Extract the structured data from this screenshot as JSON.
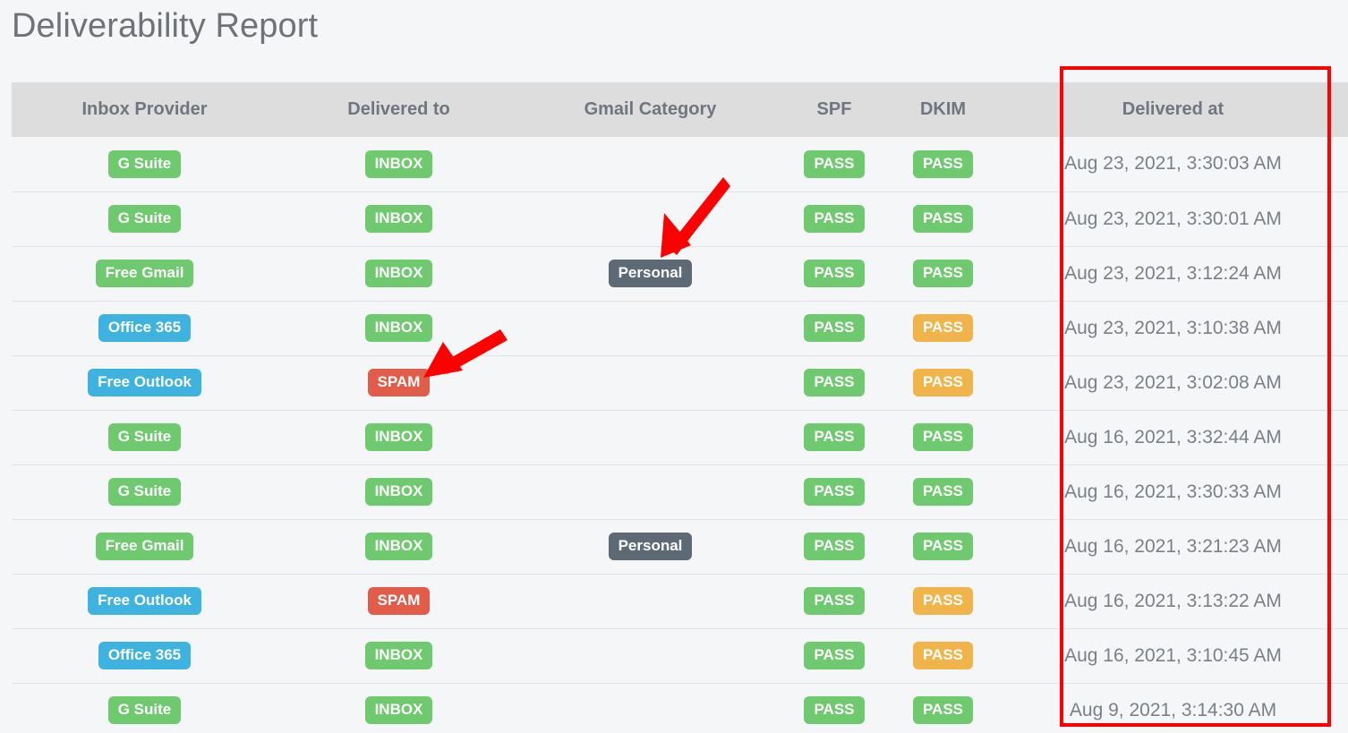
{
  "page": {
    "title": "Deliverability Report"
  },
  "table": {
    "columns": [
      {
        "key": "provider",
        "label": "Inbox Provider"
      },
      {
        "key": "delivered",
        "label": "Delivered to"
      },
      {
        "key": "category",
        "label": "Gmail Category"
      },
      {
        "key": "spf",
        "label": "SPF"
      },
      {
        "key": "dkim",
        "label": "DKIM"
      },
      {
        "key": "at",
        "label": "Delivered at"
      }
    ],
    "rows": [
      {
        "provider": "G Suite",
        "provider_color": "green",
        "delivered": "INBOX",
        "delivered_color": "green",
        "category": "",
        "category_color": "",
        "spf": "PASS",
        "spf_color": "green",
        "dkim": "PASS",
        "dkim_color": "green",
        "at": "Aug 23, 2021, 3:30:03 AM"
      },
      {
        "provider": "G Suite",
        "provider_color": "green",
        "delivered": "INBOX",
        "delivered_color": "green",
        "category": "",
        "category_color": "",
        "spf": "PASS",
        "spf_color": "green",
        "dkim": "PASS",
        "dkim_color": "green",
        "at": "Aug 23, 2021, 3:30:01 AM"
      },
      {
        "provider": "Free Gmail",
        "provider_color": "green",
        "delivered": "INBOX",
        "delivered_color": "green",
        "category": "Personal",
        "category_color": "slate",
        "spf": "PASS",
        "spf_color": "green",
        "dkim": "PASS",
        "dkim_color": "green",
        "at": "Aug 23, 2021, 3:12:24 AM"
      },
      {
        "provider": "Office 365",
        "provider_color": "blue",
        "delivered": "INBOX",
        "delivered_color": "green",
        "category": "",
        "category_color": "",
        "spf": "PASS",
        "spf_color": "green",
        "dkim": "PASS",
        "dkim_color": "amber",
        "at": "Aug 23, 2021, 3:10:38 AM"
      },
      {
        "provider": "Free Outlook",
        "provider_color": "blue",
        "delivered": "SPAM",
        "delivered_color": "red",
        "category": "",
        "category_color": "",
        "spf": "PASS",
        "spf_color": "green",
        "dkim": "PASS",
        "dkim_color": "amber",
        "at": "Aug 23, 2021, 3:02:08 AM"
      },
      {
        "provider": "G Suite",
        "provider_color": "green",
        "delivered": "INBOX",
        "delivered_color": "green",
        "category": "",
        "category_color": "",
        "spf": "PASS",
        "spf_color": "green",
        "dkim": "PASS",
        "dkim_color": "green",
        "at": "Aug 16, 2021, 3:32:44 AM"
      },
      {
        "provider": "G Suite",
        "provider_color": "green",
        "delivered": "INBOX",
        "delivered_color": "green",
        "category": "",
        "category_color": "",
        "spf": "PASS",
        "spf_color": "green",
        "dkim": "PASS",
        "dkim_color": "green",
        "at": "Aug 16, 2021, 3:30:33 AM"
      },
      {
        "provider": "Free Gmail",
        "provider_color": "green",
        "delivered": "INBOX",
        "delivered_color": "green",
        "category": "Personal",
        "category_color": "slate",
        "spf": "PASS",
        "spf_color": "green",
        "dkim": "PASS",
        "dkim_color": "green",
        "at": "Aug 16, 2021, 3:21:23 AM"
      },
      {
        "provider": "Free Outlook",
        "provider_color": "blue",
        "delivered": "SPAM",
        "delivered_color": "red",
        "category": "",
        "category_color": "",
        "spf": "PASS",
        "spf_color": "green",
        "dkim": "PASS",
        "dkim_color": "amber",
        "at": "Aug 16, 2021, 3:13:22 AM"
      },
      {
        "provider": "Office 365",
        "provider_color": "blue",
        "delivered": "INBOX",
        "delivered_color": "green",
        "category": "",
        "category_color": "",
        "spf": "PASS",
        "spf_color": "green",
        "dkim": "PASS",
        "dkim_color": "amber",
        "at": "Aug 16, 2021, 3:10:45 AM"
      },
      {
        "provider": "G Suite",
        "provider_color": "green",
        "delivered": "INBOX",
        "delivered_color": "green",
        "category": "",
        "category_color": "",
        "spf": "PASS",
        "spf_color": "green",
        "dkim": "PASS",
        "dkim_color": "green",
        "at": "Aug 9, 2021, 3:14:30 AM"
      }
    ]
  },
  "annotations": {
    "highlight_color": "#ff0000",
    "arrow_color": "#ff0000",
    "arrows": [
      {
        "name": "arrow-pointing-to-gmail-category-personal"
      },
      {
        "name": "arrow-pointing-to-delivered-to-spam"
      }
    ]
  },
  "badge_colors": {
    "green": "#6fc96f",
    "blue": "#3fb3e0",
    "red": "#e25c4a",
    "amber": "#f0b44a",
    "slate": "#5d6975"
  }
}
